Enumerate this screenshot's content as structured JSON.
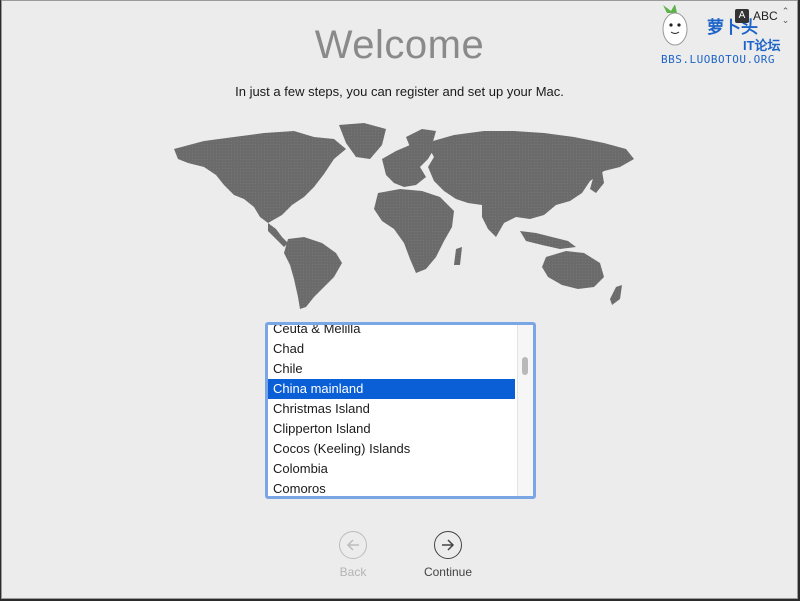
{
  "header": {
    "title": "Welcome",
    "subtitle": "In just a few steps, you can register and set up your Mac."
  },
  "input_source": {
    "icon_glyph": "A",
    "label": "ABC",
    "arrows": "⌃⌄"
  },
  "watermark": {
    "brand": "萝卜头",
    "forum": "IT论坛",
    "url": "BBS.LUOBOTOU.ORG"
  },
  "country_list": {
    "items": [
      "Ceuta & Melilla",
      "Chad",
      "Chile",
      "China mainland",
      "Christmas Island",
      "Clipperton Island",
      "Cocos (Keeling) Islands",
      "Colombia",
      "Comoros"
    ],
    "selected": "China mainland"
  },
  "navigation": {
    "back_label": "Back",
    "continue_label": "Continue",
    "back_enabled": false
  },
  "colors": {
    "selection": "#0a5fd6",
    "focus_ring": "#7aa6e6",
    "map": "#6b6b6b"
  }
}
